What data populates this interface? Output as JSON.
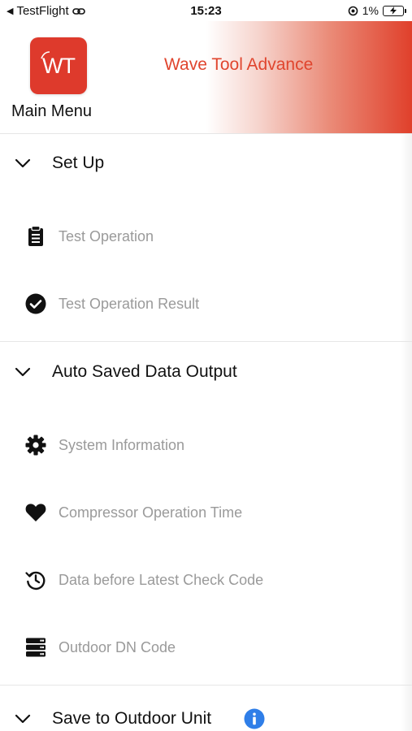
{
  "status_bar": {
    "back_app": "TestFlight",
    "time": "15:23",
    "battery": "1%"
  },
  "header": {
    "logo_text": "WT",
    "menu_label": "Main Menu",
    "app_title": "Wave Tool Advance",
    "accent_color": "#e0452e"
  },
  "sections": {
    "setup": {
      "title": "Set Up",
      "items": [
        {
          "label": "Test Operation",
          "icon": "clipboard-icon"
        },
        {
          "label": "Test Operation Result",
          "icon": "check-circle-icon"
        }
      ]
    },
    "auto_saved": {
      "title": "Auto Saved Data Output",
      "items": [
        {
          "label": "System Information",
          "icon": "gear-icon"
        },
        {
          "label": "Compressor Operation Time",
          "icon": "heart-icon"
        },
        {
          "label": "Data before Latest Check Code",
          "icon": "history-icon"
        },
        {
          "label": "Outdoor DN Code",
          "icon": "server-icon"
        }
      ]
    },
    "save_outdoor": {
      "title": "Save to Outdoor Unit",
      "info_icon": "info-icon"
    }
  }
}
